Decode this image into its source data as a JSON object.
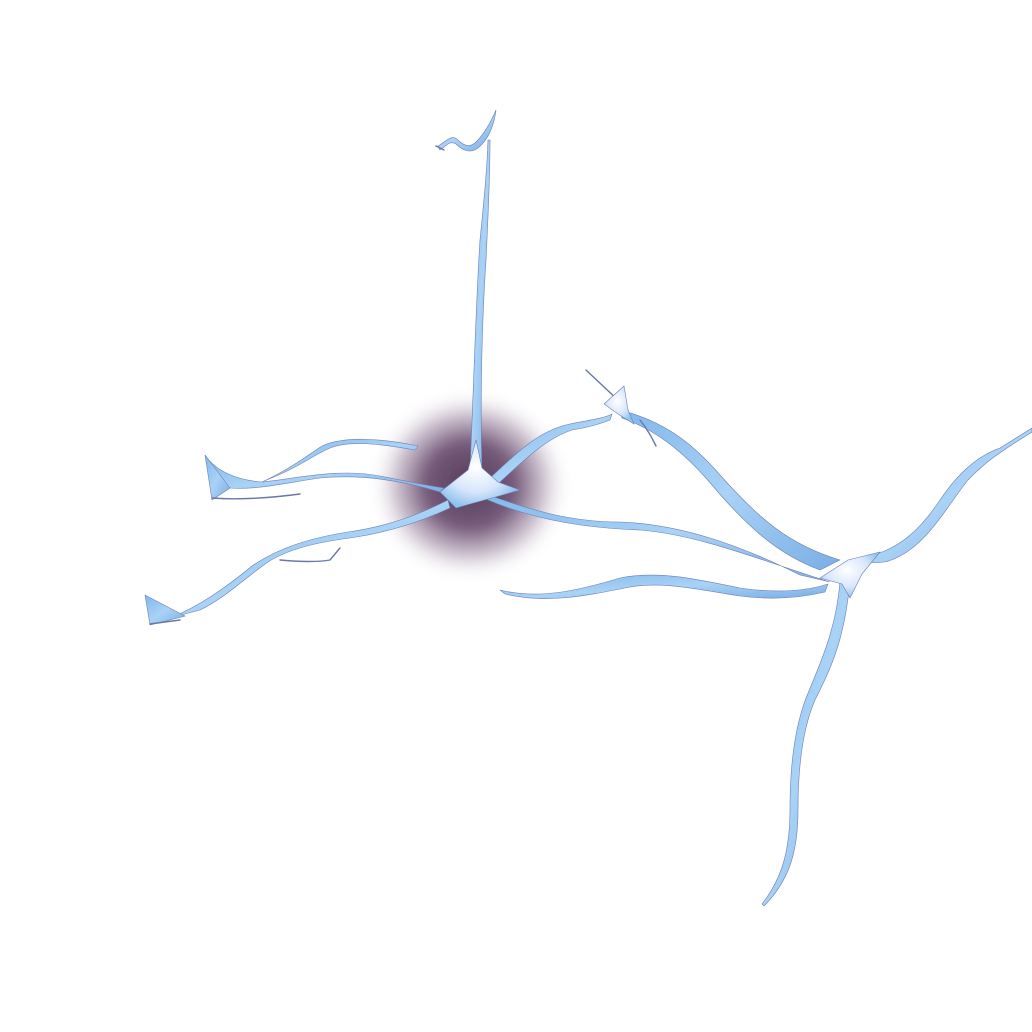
{
  "scene": {
    "subject": "neuron-3d-render",
    "background_color": "#ffffff",
    "colors": {
      "dendrite_fill": "#8ec2ef",
      "dendrite_highlight": "#f4f2ff",
      "dendrite_edge": "#6f7fb4",
      "soma_glow": "#5a3a5e"
    }
  }
}
